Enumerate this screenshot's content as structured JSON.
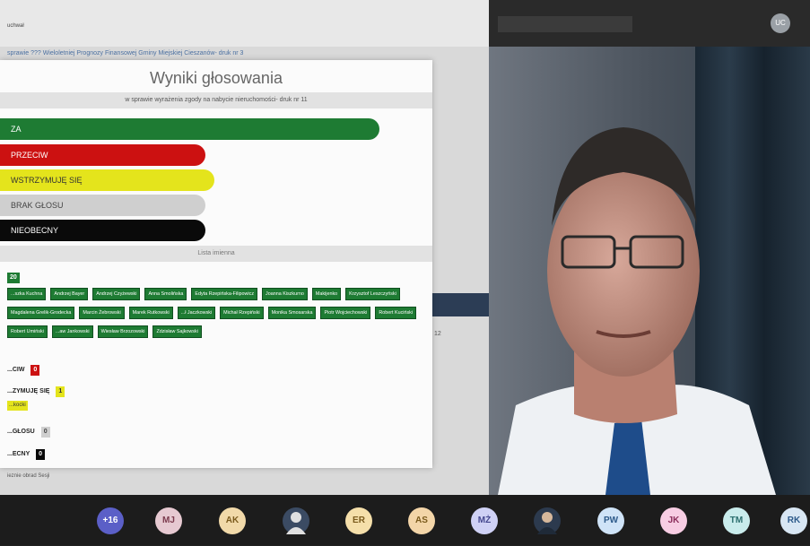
{
  "shared_screen": {
    "header": "uchwał",
    "doc_link": "sprawie ??? Wieloletniej Prognozy Finansowej Gminy Miejskiej Cieszanów- druk nr 3",
    "bg_number": "12",
    "footer": "ieznie obrad Sesji"
  },
  "results": {
    "title": "Wyniki głosowania",
    "subtitle": "w sprawie wyrażenia zgody na nabycie nieruchomości- druk nr 11",
    "bars": [
      {
        "label": "ZA",
        "fraction": 1.0,
        "color": "#1e7b33"
      },
      {
        "label": "PRZECIW",
        "color": "#cc1111"
      },
      {
        "label": "WSTRZYMUJĘ SIĘ",
        "color": "#e4e41c"
      },
      {
        "label": "BRAK GŁOSU",
        "color": "#cfcfcf"
      },
      {
        "label": "NIEOBECNY",
        "color": "#0a0a0a"
      }
    ],
    "lista_label": "Lista imienna",
    "za_count": "20",
    "za_names": [
      "...szka Kuchna",
      "Andrzej Bayer",
      "Andrzej Czyżewski",
      "Anna Smolińska",
      "Edyta Rzepińska-Filipowicz",
      "Joanna Kiszkurno",
      "Makijenko",
      "Krzysztof Leszczyński",
      "Magdalena Grelik-Grodecka",
      "Marcin Żebrowski",
      "Marek Rutkowski",
      "...ł Jaczkowski",
      "Michał Rzepiński",
      "Monika Smosarska",
      "Piotr Wojciechowski",
      "Robert Kuciński",
      "Robert Umiński",
      "...aw Jankowski",
      "Wiesław Brzozowski",
      "Zdzisław Sajkowski"
    ],
    "przeciw_label": "...CIW",
    "przeciw_count": "0",
    "wstrzymuje_label": "...ZYMUJĘ SIĘ",
    "wstrzymuje_count": "1",
    "wstrzymuje_name": "...kocki",
    "brak_label": "...GŁOSU",
    "brak_count": "0",
    "nieobecny_label": "...ECNY",
    "nieobecny_count": "0"
  },
  "video": {
    "top_avatar": "UC"
  },
  "tray": {
    "participants": [
      {
        "label": "+16",
        "color": "#5b5fc7",
        "text_color": "#ffffff"
      },
      {
        "label": "MJ",
        "color": "#e6c9d1",
        "text_color": "#7b3a4d"
      },
      {
        "label": "AK",
        "color": "#f1d9a9",
        "text_color": "#7a5a1c"
      },
      {
        "label": "",
        "color": "#3b4b63",
        "text_color": "#ffffff"
      },
      {
        "label": "ER",
        "color": "#f5dfaa",
        "text_color": "#7a5a1c"
      },
      {
        "label": "AS",
        "color": "#f3d5a8",
        "text_color": "#7a5a1c"
      },
      {
        "label": "MŻ",
        "color": "#cfd1f5",
        "text_color": "#45488f"
      },
      {
        "label": "",
        "color": "#2c3a4e",
        "text_color": "#ffffff"
      },
      {
        "label": "PW",
        "color": "#cfe3f7",
        "text_color": "#2d5a8a"
      },
      {
        "label": "JK",
        "color": "#f7cde3",
        "text_color": "#8a2d5a"
      },
      {
        "label": "TM",
        "color": "#c9ecec",
        "text_color": "#2c6f6f"
      },
      {
        "label": "RK",
        "color": "#d8e6f3",
        "text_color": "#2d5a8a"
      }
    ]
  }
}
